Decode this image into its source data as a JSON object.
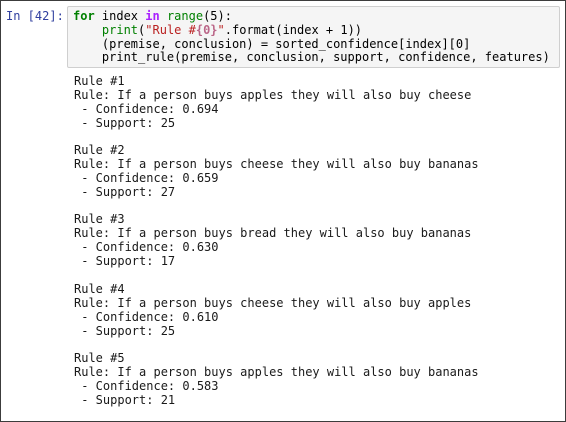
{
  "cell": {
    "prompt": "In [42]:"
  },
  "code": {
    "line1": {
      "kw_for": "for",
      "var": " index ",
      "kw_in": "in",
      "sp": " ",
      "fn_range": "range",
      "args": "(5):"
    },
    "line2": {
      "indent": "    ",
      "fn_print": "print",
      "open": "(",
      "str_a": "\"Rule #",
      "str_interp": "{0}",
      "str_b": "\"",
      "rest": ".format(index + 1))"
    },
    "line3": "    (premise, conclusion) = sorted_confidence[index][0]",
    "line4": "    print_rule(premise, conclusion, support, confidence, features)"
  },
  "output": {
    "rules": [
      {
        "title": "Rule #1",
        "text": "Rule: If a person buys apples they will also buy cheese",
        "confidence": " - Confidence: 0.694",
        "support": " - Support: 25"
      },
      {
        "title": "Rule #2",
        "text": "Rule: If a person buys cheese they will also buy bananas",
        "confidence": " - Confidence: 0.659",
        "support": " - Support: 27"
      },
      {
        "title": "Rule #3",
        "text": "Rule: If a person buys bread they will also buy bananas",
        "confidence": " - Confidence: 0.630",
        "support": " - Support: 17"
      },
      {
        "title": "Rule #4",
        "text": "Rule: If a person buys cheese they will also buy apples",
        "confidence": " - Confidence: 0.610",
        "support": " - Support: 25"
      },
      {
        "title": "Rule #5",
        "text": "Rule: If a person buys apples they will also buy bananas",
        "confidence": " - Confidence: 0.583",
        "support": " - Support: 21"
      }
    ]
  }
}
